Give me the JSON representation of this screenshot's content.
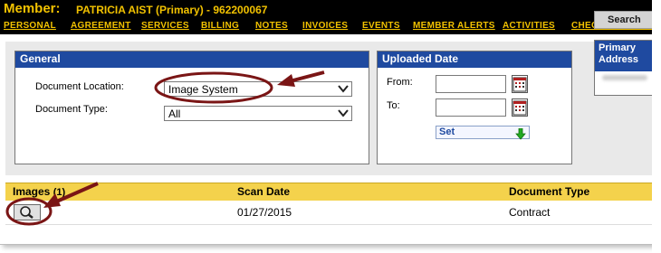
{
  "member": {
    "label": "Member:",
    "name_line": "PATRICIA  AIST (Primary) - 962200067"
  },
  "nav": {
    "items": [
      "PERSONAL",
      "AGREEMENT",
      "SERVICES",
      "BILLING",
      "NOTES",
      "INVOICES",
      "EVENTS",
      "MEMBER ALERTS",
      "ACTIVITIES",
      "CHECK IN HISTORY"
    ]
  },
  "general": {
    "title": "General",
    "document_location_label": "Document Location:",
    "document_location_value": "Image System",
    "document_type_label": "Document Type:",
    "document_type_value": "All"
  },
  "uploaded": {
    "title": "Uploaded Date",
    "from_label": "From:",
    "to_label": "To:",
    "set_label": "Set"
  },
  "search": {
    "label": "Search"
  },
  "primary": {
    "title_line1": "Primary",
    "title_line2": "Address"
  },
  "images": {
    "title": "Images",
    "count": "(1)",
    "col_scan_date": "Scan Date",
    "col_document_type": "Document Type",
    "rows": [
      {
        "scan_date": "01/27/2015",
        "document_type": "Contract"
      }
    ]
  },
  "colors": {
    "member_bar_bg": "#000000",
    "member_text": "#f2c200",
    "panel_header": "#1f4aa0",
    "images_header": "#f4d24c",
    "annotation": "#7a1515"
  }
}
